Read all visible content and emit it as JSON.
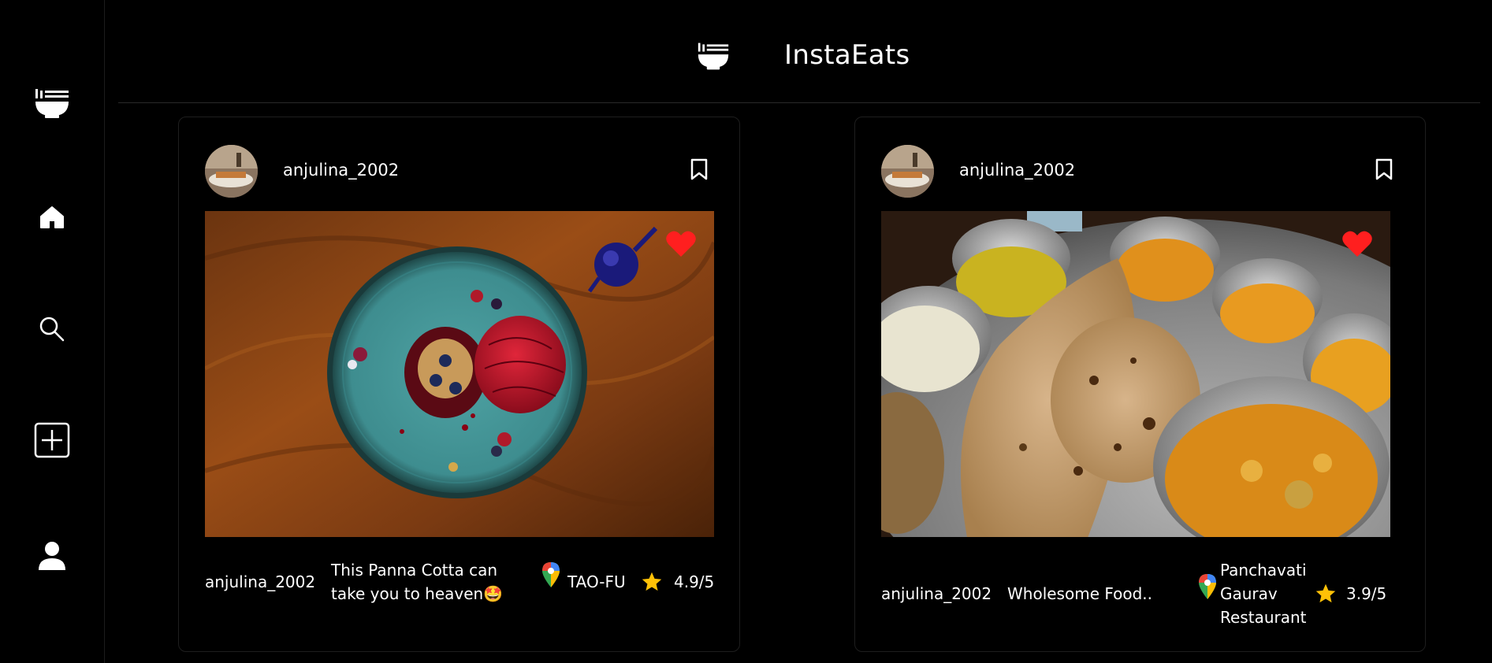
{
  "app": {
    "title": "InstaEats",
    "logo_icon": "noodle-bowl-icon"
  },
  "sidebar": {
    "items": [
      {
        "name": "logo",
        "icon": "noodle-bowl-icon"
      },
      {
        "name": "home",
        "icon": "home-icon"
      },
      {
        "name": "search",
        "icon": "search-icon"
      },
      {
        "name": "create",
        "icon": "plus-square-icon"
      },
      {
        "name": "profile",
        "icon": "user-icon"
      }
    ]
  },
  "posts": [
    {
      "username": "anjulina_2002",
      "footer_username": "anjulina_2002",
      "caption_line1": "This Panna Cotta can",
      "caption_line2": "take you to heaven🤩",
      "location": "TAO-FU",
      "rating": "4.9/5",
      "liked": true,
      "image": "panna-cotta-dessert-photo"
    },
    {
      "username": "anjulina_2002",
      "footer_username": "anjulina_2002",
      "caption": "Wholesome Food..",
      "location_line1": "Panchavati",
      "location_line2": "Gaurav",
      "location_line3": "Restaurant",
      "rating": "3.9/5",
      "liked": true,
      "image": "indian-thali-photo"
    }
  ],
  "colors": {
    "background": "#000000",
    "heart": "#ff1f1f",
    "star": "#ffc107",
    "text": "#ffffff"
  }
}
